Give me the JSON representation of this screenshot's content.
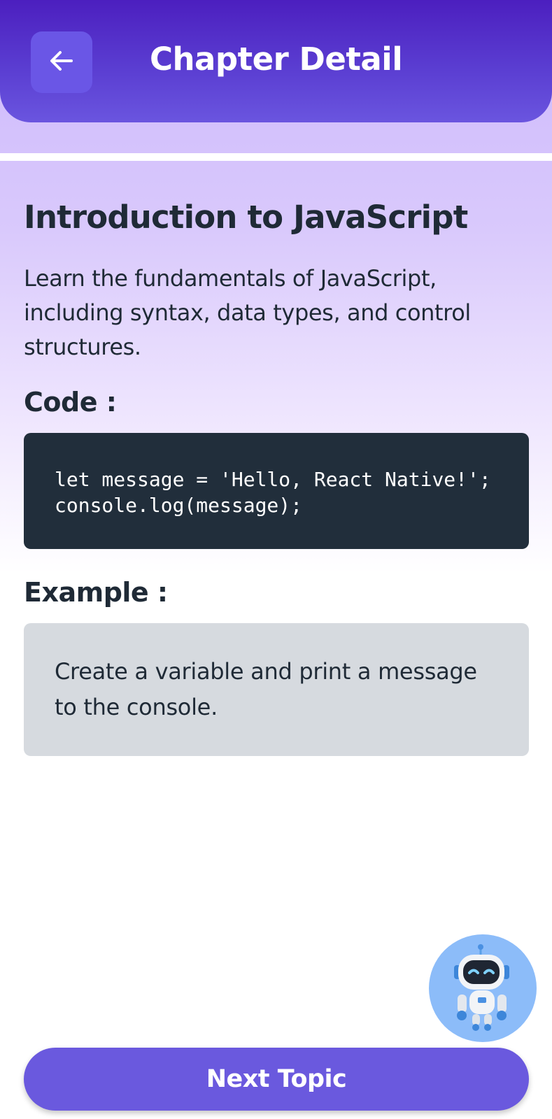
{
  "header": {
    "title": "Chapter Detail",
    "back_icon": "arrow-left-icon"
  },
  "chapter": {
    "title": "Introduction to JavaScript",
    "description": "Learn the fundamentals of JavaScript, including syntax, data types, and control structures.",
    "code_label": "Code :",
    "code": "let message = 'Hello, React Native!'; console.log(message);",
    "example_label": "Example :",
    "example": "Create a variable and print a message to the console."
  },
  "footer": {
    "next_label": "Next Topic",
    "assistant_icon": "robot-icon"
  },
  "colors": {
    "header_bg": "#5a3dd1",
    "accent": "#6a59de",
    "code_bg": "#212e3b",
    "example_bg": "#d6dadf",
    "assistant_bg": "#8cbcf9"
  }
}
